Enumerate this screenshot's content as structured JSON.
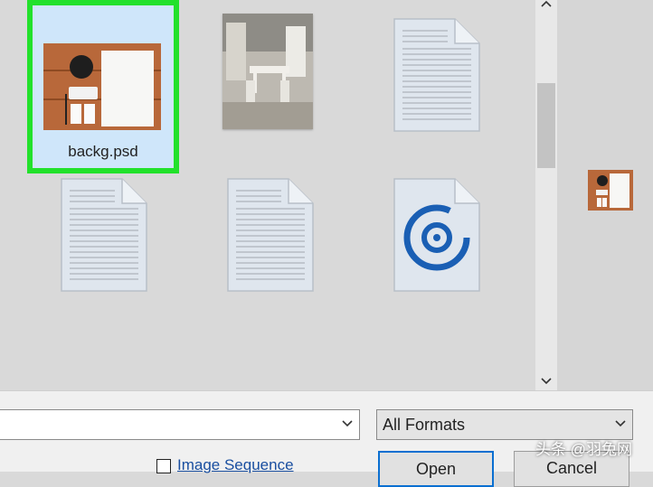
{
  "files": [
    {
      "name": "backg.psd",
      "type": "image-desk",
      "selected": true
    },
    {
      "name": "",
      "type": "image-room",
      "selected": false
    },
    {
      "name": "",
      "type": "document",
      "selected": false
    },
    {
      "name": "",
      "type": "document",
      "selected": false
    },
    {
      "name": "",
      "type": "document",
      "selected": false
    },
    {
      "name": "",
      "type": "groove-music-file",
      "selected": false
    }
  ],
  "scrollbar": {
    "up_arrow": "^",
    "down_arrow": "v"
  },
  "footer": {
    "filename_value": "",
    "format_selected": "All Formats",
    "image_sequence_label": "Image Sequence",
    "image_sequence_checked": false,
    "open_label": "Open",
    "cancel_label": "Cancel"
  },
  "colors": {
    "selection_border": "#22e12b",
    "selection_fill": "#cfe6fa",
    "open_button_border": "#0a6fd1",
    "link_blue": "#1a4fa0",
    "groove_icon": "#1a5fb4"
  },
  "watermark": "头条 @羽兔网"
}
